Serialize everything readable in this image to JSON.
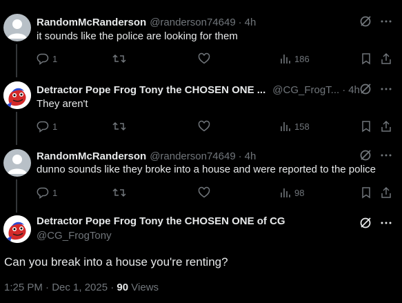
{
  "tweets": [
    {
      "name": "RandomMcRanderson",
      "handle": "@randerson74649",
      "time": "4h",
      "text": "it sounds like the police are looking for them",
      "replies": "1",
      "views": "186"
    },
    {
      "name": "Detractor Pope Frog Tony the CHOSEN ONE ...",
      "handle": "@CG_FrogT...",
      "time": "4h",
      "text": "They aren't",
      "replies": "1",
      "views": "158"
    },
    {
      "name": "RandomMcRanderson",
      "handle": "@randerson74649",
      "time": "4h",
      "text": "dunno sounds like they broke into a house and were reported to the police",
      "replies": "1",
      "views": "98"
    }
  ],
  "main_tweet": {
    "name": "Detractor Pope Frog Tony the CHOSEN ONE of CG",
    "handle": "@CG_FrogTony",
    "text": "Can you break into a house you're renting?",
    "timestamp": "1:25 PM · Dec 1, 2025 ·",
    "views_count": "90",
    "views_label": "Views"
  },
  "separator": "·",
  "icons": {
    "grok": "grok-icon",
    "more": "more-icon",
    "reply": "reply-icon",
    "retweet": "retweet-icon",
    "like": "like-icon",
    "views": "views-icon",
    "bookmark": "bookmark-icon",
    "share": "share-icon"
  },
  "colors": {
    "background": "#000000",
    "text": "#e7e9ea",
    "muted": "#71767b",
    "thread_line": "#333639"
  }
}
